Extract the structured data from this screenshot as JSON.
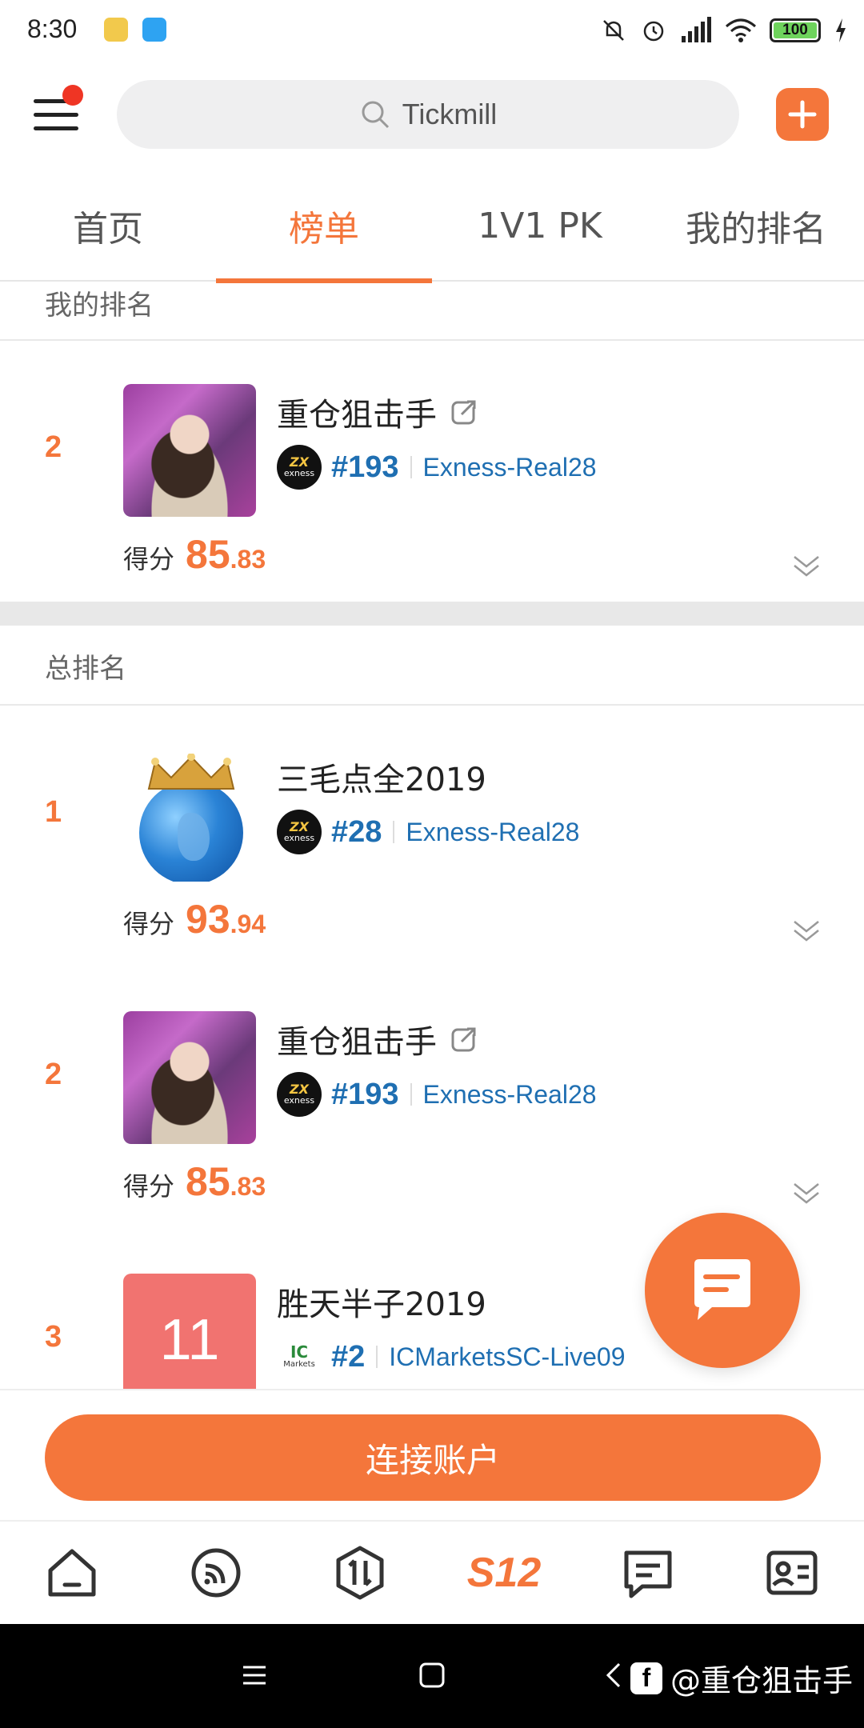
{
  "status_bar": {
    "time": "8:30",
    "battery": "100"
  },
  "header": {
    "search_value": "Tickmill"
  },
  "tabs": [
    {
      "label": "首页"
    },
    {
      "label": "榜单"
    },
    {
      "label": "1V1 PK"
    },
    {
      "label": "我的排名"
    }
  ],
  "my_ranking": {
    "title": "我的排名",
    "entry": {
      "rank": "2",
      "name": "重仓狙击手",
      "num": "#193",
      "server": "Exness-Real28",
      "score_label": "得分",
      "score_int": "85",
      "score_dec": ".83"
    }
  },
  "overall": {
    "title": "总排名",
    "entries": [
      {
        "rank": "1",
        "name": "三毛点全2019",
        "num": "#28",
        "server": "Exness-Real28",
        "score_label": "得分",
        "score_int": "93",
        "score_dec": ".94"
      },
      {
        "rank": "2",
        "name": "重仓狙击手",
        "num": "#193",
        "server": "Exness-Real28",
        "score_label": "得分",
        "score_int": "85",
        "score_dec": ".83"
      },
      {
        "rank": "3",
        "name": "胜天半子2019",
        "num": "#2",
        "server": "ICMarketsSC-Live09",
        "avatar_text": "11"
      }
    ]
  },
  "broker_logos": {
    "exness": "exness",
    "exness_mark": "ZX",
    "icmarkets": "IC",
    "icmarkets_sub": "Markets"
  },
  "action": {
    "connect_label": "连接账户"
  },
  "bottom_nav": {
    "s12_label": "S12"
  },
  "watermark": {
    "fb": "f",
    "text": "@重仓狙击手"
  },
  "colors": {
    "accent": "#f4763b",
    "link": "#1f6fb2"
  }
}
